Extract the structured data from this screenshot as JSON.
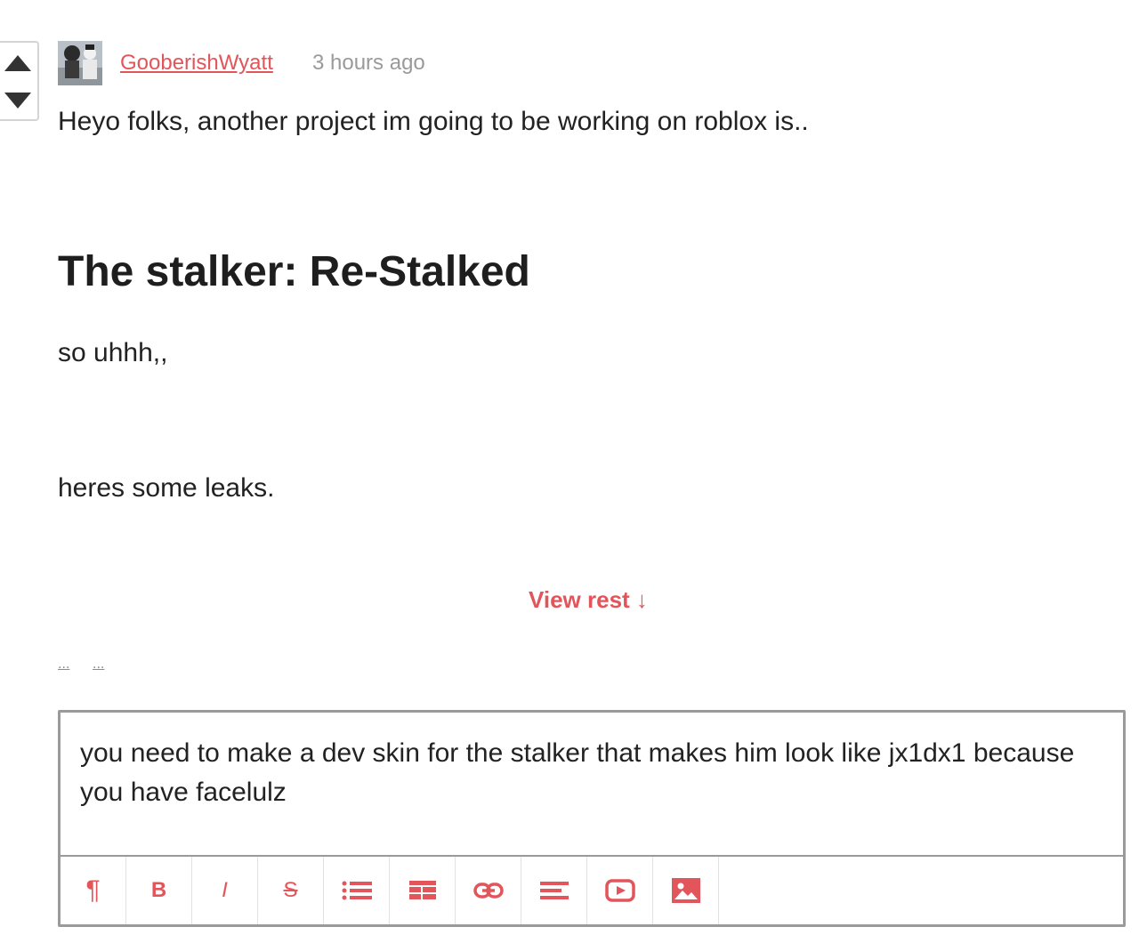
{
  "comment": {
    "author": "GooberishWyatt",
    "time": "3 hours ago",
    "body": {
      "intro": "Heyo folks, another project im going to be working on roblox is..",
      "heading": "The stalker: Re-Stalked",
      "line2": "so uhhh,,",
      "line3": "heres some leaks."
    },
    "view_rest": "View rest ↓",
    "more_links": [
      "...",
      "..."
    ]
  },
  "reply_editor": {
    "value": "you need to make a dev skin for the stalker that makes him look like jx1dx1 because you have facelulz",
    "toolbar": [
      {
        "icon": "pilcrow-icon",
        "glyph": "¶"
      },
      {
        "icon": "bold-icon",
        "glyph": "B"
      },
      {
        "icon": "italic-icon",
        "glyph": "I"
      },
      {
        "icon": "strikethrough-icon",
        "glyph": "S"
      },
      {
        "icon": "bullet-list-icon"
      },
      {
        "icon": "table-icon"
      },
      {
        "icon": "link-icon"
      },
      {
        "icon": "align-left-icon"
      },
      {
        "icon": "video-icon"
      },
      {
        "icon": "image-icon"
      }
    ]
  },
  "colors": {
    "accent": "#e2555a",
    "muted": "#9a9a9a",
    "text": "#222222"
  }
}
